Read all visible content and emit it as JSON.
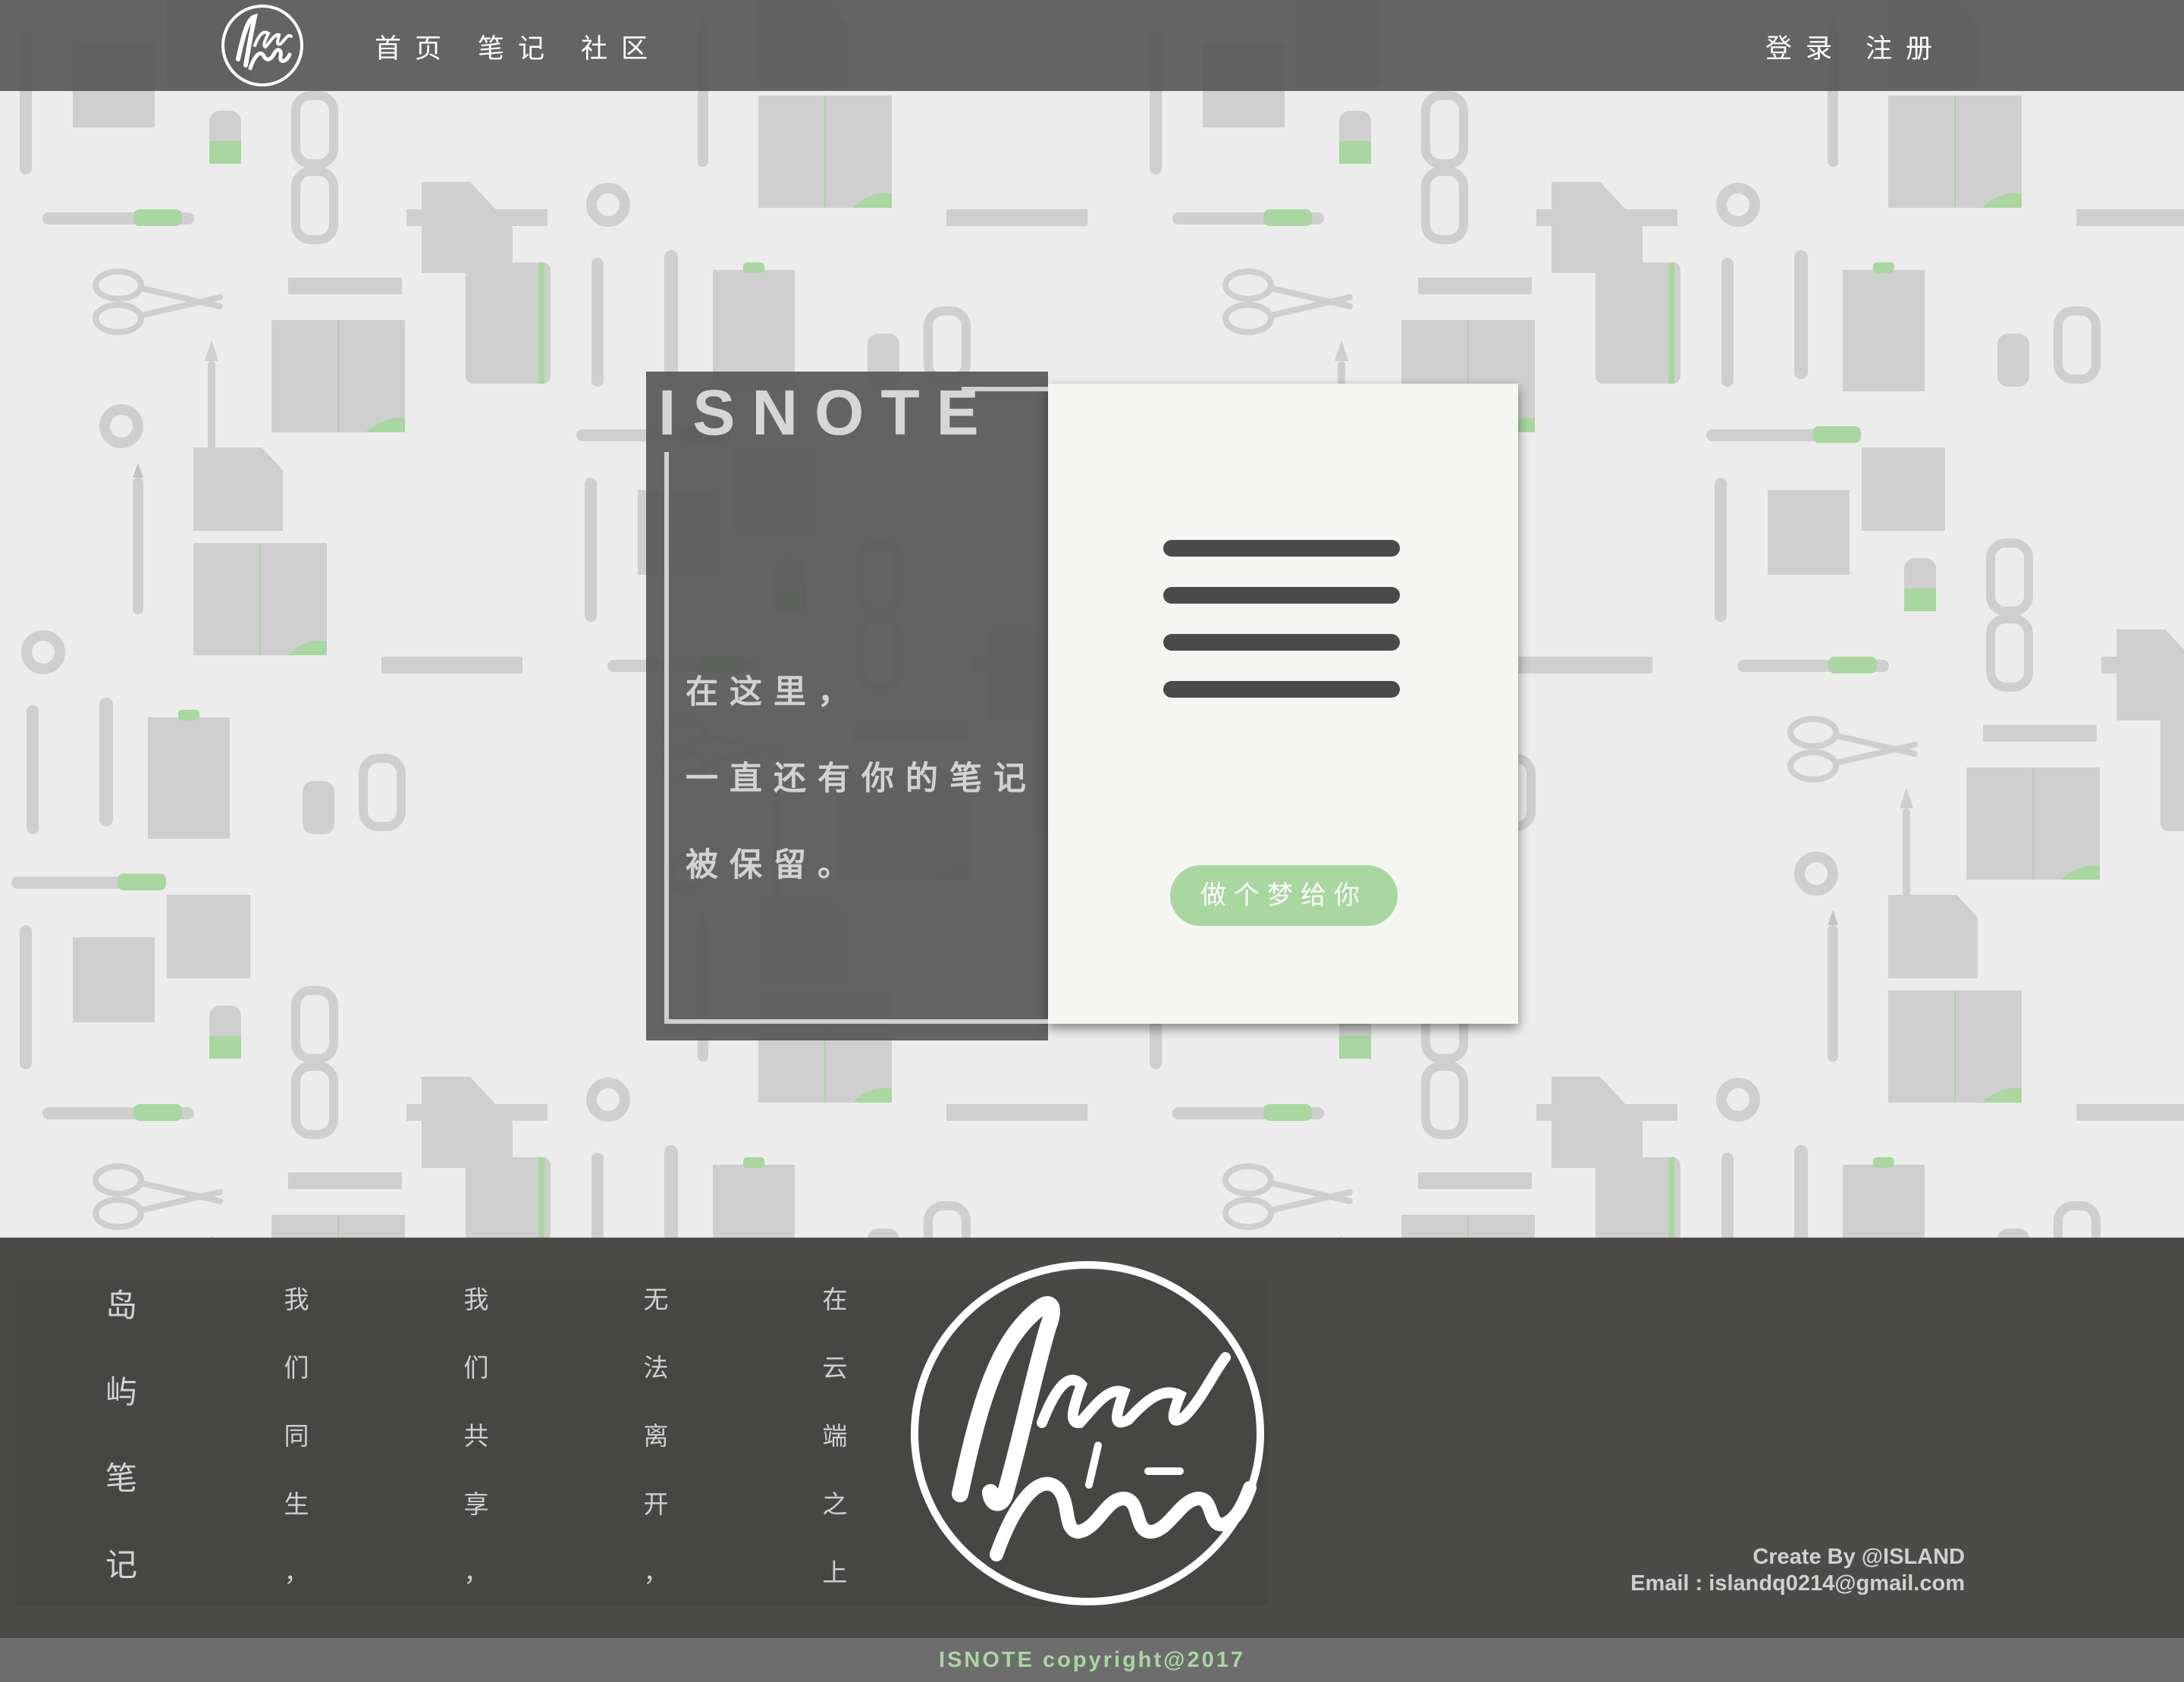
{
  "brand": {
    "logo_text_top": "Island",
    "logo_text_bottom": "Note"
  },
  "nav": {
    "links": [
      "首页",
      "笔记",
      "社区"
    ],
    "login": "登录",
    "register": "注册"
  },
  "hero": {
    "title": "ISNOTE",
    "lines": [
      "在这里，",
      "一直还有你的笔记",
      "被保留。"
    ],
    "button_label": "做个梦给你",
    "menu_icon": "hamburger-menu-icon"
  },
  "footer": {
    "columns": [
      "岛屿笔记",
      "我们同生，",
      "我们共享，",
      "无法离开，",
      "在云端之上。"
    ],
    "credit_author": "Create By @ISLAND",
    "credit_email": "Email : islandq0214@gmail.com",
    "copyright": "ISNOTE copyright@2017"
  },
  "colors": {
    "accent_green": "#a8d7a0",
    "dark_gray": "#4b4b4a",
    "nav_gray": "#585858",
    "background": "#ececec"
  }
}
